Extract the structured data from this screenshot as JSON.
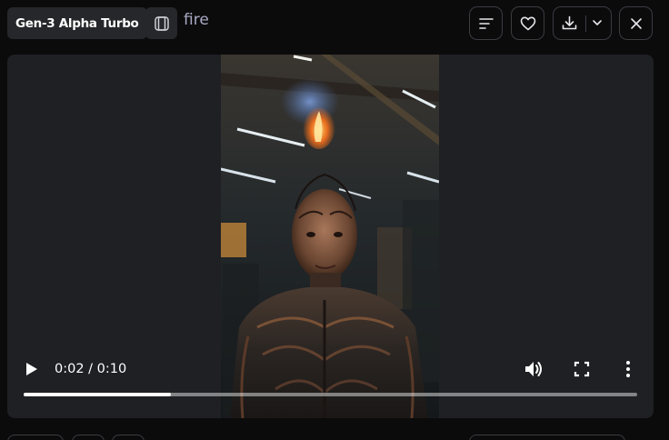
{
  "header": {
    "model_label": "Gen-3 Alpha Turbo",
    "frame_icon": "film-frame-icon",
    "prompt": "fire",
    "actions": [
      {
        "name": "details",
        "icon": "menu-lines-icon"
      },
      {
        "name": "favorite",
        "icon": "heart-icon"
      },
      {
        "name": "download",
        "icon": "download-icon"
      },
      {
        "name": "download-options",
        "icon": "chevron-down-icon"
      },
      {
        "name": "close",
        "icon": "close-icon"
      }
    ]
  },
  "player": {
    "time_display": "0:02 / 0:10",
    "current_seconds": 2,
    "duration_seconds": 10,
    "progress_fraction": 0.24,
    "controls": [
      "play-icon",
      "volume-icon",
      "fullscreen-icon",
      "more-vertical-icon"
    ]
  },
  "colors": {
    "background": "#0b0b0c",
    "panel": "#1f2024",
    "badge": "#26272b",
    "border": "#3b3c41",
    "prompt_text": "#a9a9c4"
  }
}
